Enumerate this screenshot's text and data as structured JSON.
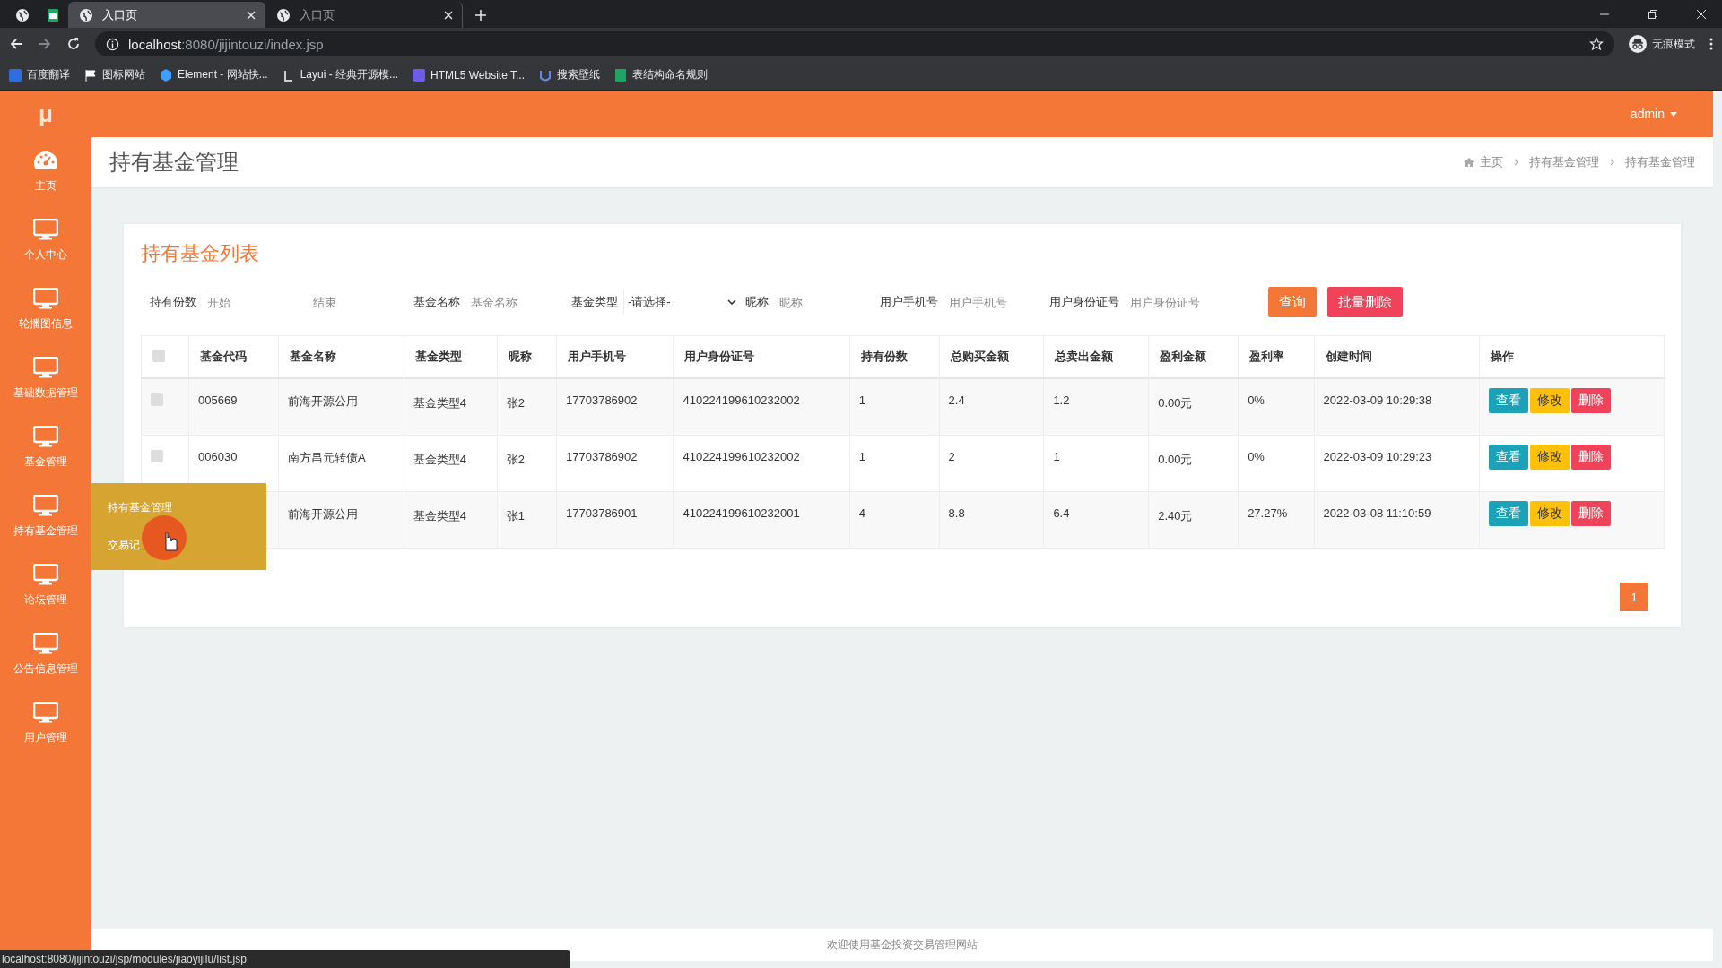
{
  "browser": {
    "tabs": [
      {
        "kind": "pinned",
        "selected": false
      },
      {
        "kind": "pinned",
        "selected": false
      },
      {
        "kind": "tab",
        "title": "入口页",
        "selected": true
      },
      {
        "kind": "tab",
        "title": "入口页",
        "selected": false
      }
    ],
    "address": {
      "host": "localhost",
      "rest": ":8080/jijintouzi/index.jsp"
    },
    "profile": "无痕模式",
    "bookmarks": [
      "百度翻译",
      "图标网站",
      "Element - 网站快...",
      "Layui - 经典开源模...",
      "HTML5 Website T...",
      "搜索壁纸",
      "表结构命名规则"
    ]
  },
  "app": {
    "logo": "μ",
    "user": "admin",
    "sidebar": [
      {
        "kind": "dashboard",
        "label": "主页"
      },
      {
        "kind": "monitor",
        "label": "个人中心"
      },
      {
        "kind": "monitor",
        "label": "轮播图信息"
      },
      {
        "kind": "monitor",
        "label": "基础数据管理"
      },
      {
        "kind": "monitor",
        "label": "基金管理"
      },
      {
        "kind": "monitor",
        "label": "持有基金管理"
      },
      {
        "kind": "monitor",
        "label": "论坛管理"
      },
      {
        "kind": "monitor",
        "label": "公告信息管理"
      },
      {
        "kind": "monitor",
        "label": "用户管理"
      }
    ],
    "submenu": [
      "持有基金管理",
      "交易记"
    ],
    "page_title": "持有基金管理",
    "breadcrumb": [
      "主页",
      "持有基金管理",
      "持有基金管理"
    ],
    "card_title": "持有基金列表",
    "filters": [
      {
        "label": "持有份数",
        "kind": "input",
        "placeholder": "开始"
      },
      {
        "kind": "input",
        "placeholder": "结束"
      },
      {
        "label": "基金名称",
        "kind": "input",
        "placeholder": "基金名称"
      },
      {
        "label": "基金类型",
        "kind": "select",
        "value": "-请选择-"
      },
      {
        "label": "昵称",
        "kind": "input",
        "placeholder": "昵称"
      },
      {
        "label": "用户手机号",
        "kind": "input",
        "placeholder": "用户手机号"
      },
      {
        "label": "用户身份证号",
        "kind": "input",
        "placeholder": "用户身份证号"
      }
    ],
    "filter_buttons": [
      {
        "label": "查询",
        "kind": "search"
      },
      {
        "label": "批量删除",
        "kind": "delete"
      }
    ],
    "table": {
      "select_all": {
        "checked": false
      },
      "columns": [
        "基金代码",
        "基金名称",
        "基金类型",
        "昵称",
        "用户手机号",
        "用户身份证号",
        "持有份数",
        "总购买金额",
        "总卖出金额",
        "盈利金额",
        "盈利率",
        "创建时间",
        "操作"
      ],
      "rows": [
        {
          "checked": false,
          "cells": [
            "005669",
            "前海开源公用",
            "基金类型4",
            "张2",
            "17703786902",
            "410224199610232002",
            "1",
            "2.4",
            "1.2",
            "0.00元",
            "0%",
            "2022-03-09 10:29:38"
          ],
          "actions": [
            {
              "label": "查看",
              "kind": "view"
            },
            {
              "label": "修改",
              "kind": "edit"
            },
            {
              "label": "删除",
              "kind": "delete"
            }
          ]
        },
        {
          "checked": false,
          "cells": [
            "006030",
            "南方昌元转债A",
            "基金类型4",
            "张2",
            "17703786902",
            "410224199610232002",
            "1",
            "2",
            "1",
            "0.00元",
            "0%",
            "2022-03-09 10:29:23"
          ],
          "actions": [
            {
              "label": "查看",
              "kind": "view"
            },
            {
              "label": "修改",
              "kind": "edit"
            },
            {
              "label": "删除",
              "kind": "delete"
            }
          ]
        },
        {
          "cells": [
            "",
            "前海开源公用",
            "基金类型4",
            "张1",
            "17703786901",
            "410224199610232001",
            "4",
            "8.8",
            "6.4",
            "2.40元",
            "27.27%",
            "2022-03-08 11:10:59"
          ],
          "actions": [
            {
              "label": "查看",
              "kind": "view"
            },
            {
              "label": "修改",
              "kind": "edit"
            },
            {
              "label": "删除",
              "kind": "delete"
            }
          ]
        }
      ]
    },
    "pages": [
      {
        "label": "1",
        "selected": true
      }
    ],
    "footer": "欢迎使用基金投资交易管理网站"
  },
  "status_url": "localhost:8080/jijintouzi/jsp/modules/jiaoyijilu/list.jsp"
}
